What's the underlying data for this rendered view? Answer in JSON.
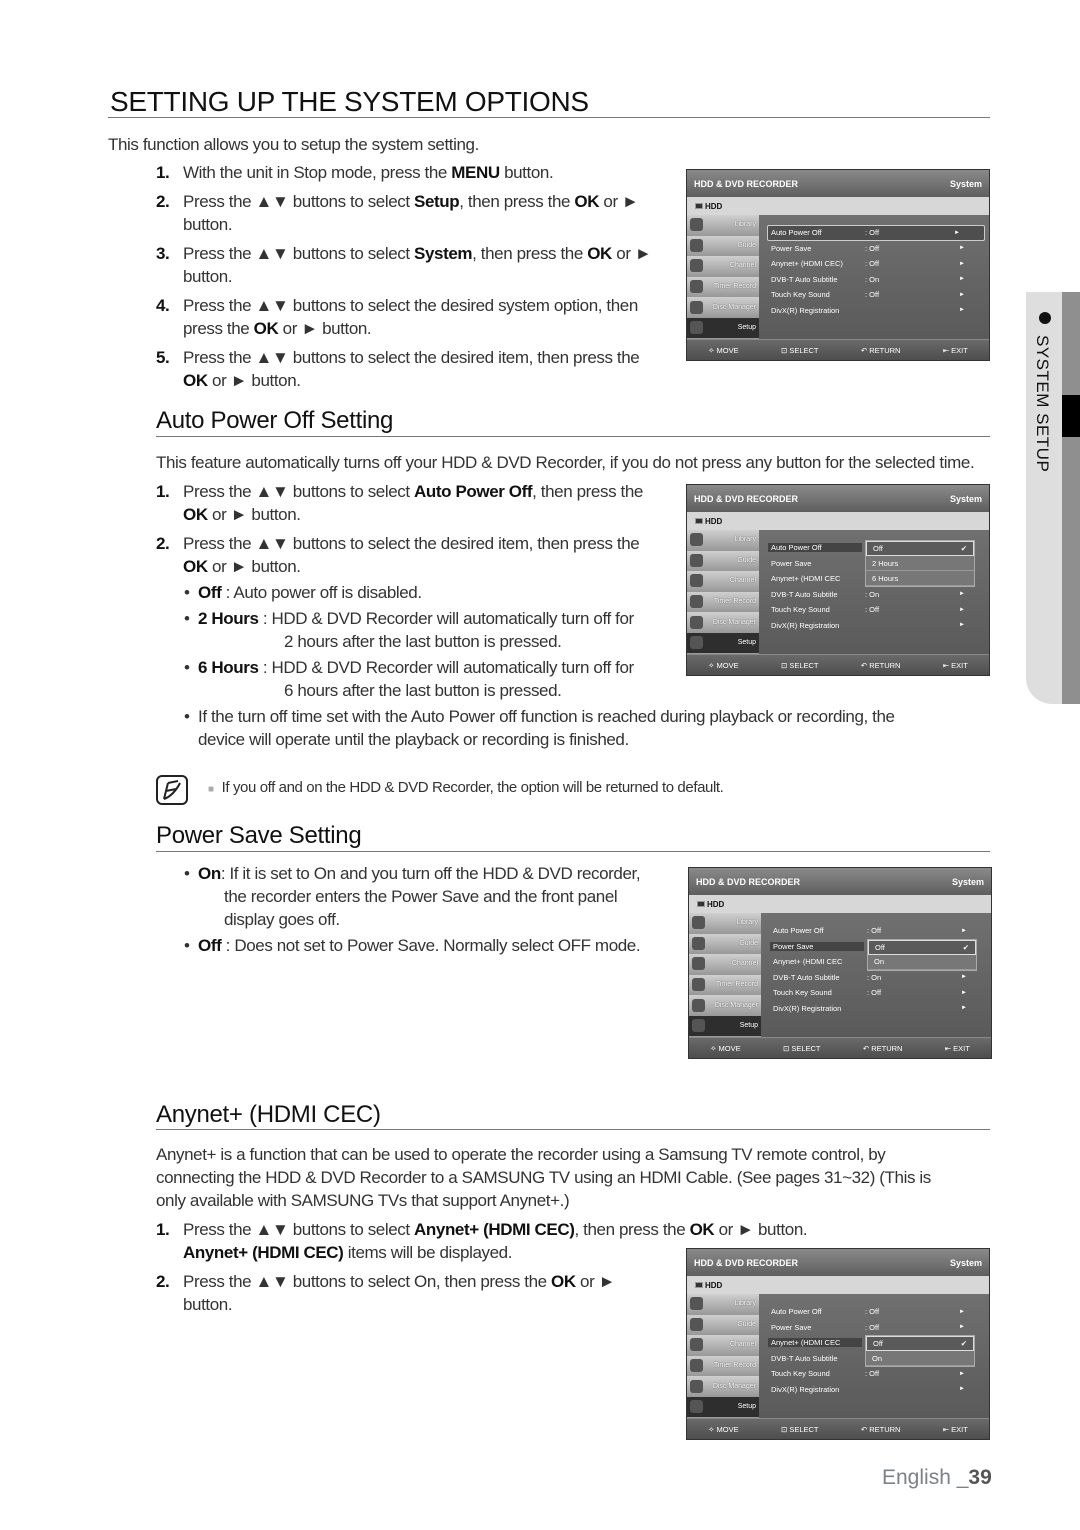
{
  "page_title": "SETTING UP THE SYSTEM OPTIONS",
  "intro": "This function allows you to setup the system setting.",
  "steps_intro": [
    {
      "num": "1.",
      "lines": [
        [
          "With the unit in Stop mode, press the ",
          {
            "b": "MENU"
          },
          " button."
        ]
      ]
    },
    {
      "num": "2.",
      "lines": [
        [
          "Press the ▲▼ buttons to select ",
          {
            "b": "Setup"
          },
          ", then press the ",
          {
            "b": "OK"
          },
          " or ►"
        ],
        [
          "button."
        ]
      ]
    },
    {
      "num": "3.",
      "lines": [
        [
          "Press the ▲▼ buttons to select ",
          {
            "b": "System"
          },
          ", then press the ",
          {
            "b": "OK"
          },
          " or ►"
        ],
        [
          "button."
        ]
      ]
    },
    {
      "num": "4.",
      "lines": [
        [
          "Press the ▲▼ buttons to select the desired system option, then"
        ],
        [
          "press the ",
          {
            "b": "OK"
          },
          " or ► button."
        ]
      ]
    },
    {
      "num": "5.",
      "lines": [
        [
          "Press the ▲▼ buttons to select the desired item, then press the"
        ],
        [
          {
            "b": "OK"
          },
          " or ► button."
        ]
      ]
    }
  ],
  "auto_power": {
    "heading": "Auto Power Off Setting",
    "desc": "This feature automatically turns off your HDD & DVD Recorder, if you do not press any button for the selected time.",
    "steps": [
      {
        "num": "1.",
        "lines": [
          [
            "Press the ▲▼ buttons to select ",
            {
              "b": "Auto Power Off"
            },
            ", then press the"
          ],
          [
            {
              "b": "OK"
            },
            " or ► button."
          ]
        ]
      },
      {
        "num": "2.",
        "lines": [
          [
            "Press the ▲▼ buttons to select the desired item, then press the"
          ],
          [
            {
              "b": "OK"
            },
            " or ► button."
          ]
        ]
      }
    ],
    "bullets": [
      {
        "lines": [
          [
            {
              "b": "Off"
            },
            " : Auto power off is disabled."
          ]
        ]
      },
      {
        "lines": [
          [
            {
              "b": "2 Hours"
            },
            " : HDD & DVD Recorder will automatically turn off for"
          ],
          [
            "2 hours after the last button is pressed."
          ]
        ]
      },
      {
        "lines": [
          [
            {
              "b": "6 Hours"
            },
            " : HDD & DVD Recorder will automatically turn off for"
          ],
          [
            "6 hours after the last button is pressed."
          ]
        ]
      },
      {
        "lines": [
          [
            "If the turn off time set with the Auto Power off function is reached during playback or recording, the"
          ],
          [
            "device will operate until the playback or recording is finished."
          ]
        ]
      }
    ],
    "note": "If you off and on the HDD & DVD Recorder, the option will be returned to default."
  },
  "power_save": {
    "heading": "Power Save Setting",
    "bullets": [
      {
        "lines": [
          [
            {
              "b": "On"
            },
            ": If it is set to On and you turn off the HDD & DVD recorder,"
          ],
          [
            "the recorder enters the Power Save and the front panel"
          ],
          [
            "display goes off."
          ]
        ]
      },
      {
        "lines": [
          [
            {
              "b": "Off"
            },
            " : Does not set to Power Save. Normally select  OFF mode."
          ]
        ]
      }
    ]
  },
  "anynet": {
    "heading": "Anynet+ (HDMI CEC)",
    "desc": [
      "Anynet+ is a function that can be used to operate the recorder using a Samsung TV remote control, by",
      "connecting the HDD & DVD Recorder to a SAMSUNG TV using an HDMI Cable. (See pages 31~32) (This is",
      "only available with SAMSUNG TVs that support Anynet+.)"
    ],
    "steps": [
      {
        "num": "1.",
        "lines": [
          [
            "Press the ▲▼ buttons to select ",
            {
              "b": "Anynet+ (HDMI CEC)"
            },
            ", then press the ",
            {
              "b": "OK"
            },
            " or ► button."
          ],
          [
            {
              "b": "Anynet+ (HDMI CEC)"
            },
            " items will be displayed."
          ]
        ]
      },
      {
        "num": "2.",
        "lines": [
          [
            "Press the ▲▼ buttons to select On, then press the ",
            {
              "b": "OK"
            },
            " or ►"
          ],
          [
            "button."
          ]
        ]
      }
    ]
  },
  "osd_common": {
    "title": "HDD & DVD RECORDER",
    "section": "System",
    "source": "HDD",
    "sidebar": [
      "Library",
      "Guide",
      "Channel",
      "Timer Record",
      "Disc Manager",
      "Setup"
    ],
    "sidebar_active": 5,
    "footer": [
      "MOVE",
      "SELECT",
      "RETURN",
      "EXIT"
    ],
    "footer_icons": [
      "move-icon",
      "select-icon",
      "return-icon",
      "exit-icon"
    ]
  },
  "osd_screens": [
    {
      "rows": [
        [
          "Auto Power Off",
          ": Off"
        ],
        [
          "Power Save",
          ": Off"
        ],
        [
          "Anynet+ (HDMI CEC)",
          ": Off"
        ],
        [
          "DVB-T Auto Subtitle",
          ": On"
        ],
        [
          "Touch Key Sound",
          ": Off"
        ],
        [
          "DivX(R) Registration",
          ""
        ]
      ],
      "selected": 0,
      "popup": null
    },
    {
      "rows": [
        [
          "Auto Power Off",
          ""
        ],
        [
          "Power Save",
          ""
        ],
        [
          "Anynet+ (HDMI CEC",
          ""
        ],
        [
          "DVB-T Auto Subtitle",
          ": On"
        ],
        [
          "Touch Key Sound",
          ": Off"
        ],
        [
          "DivX(R) Registration",
          ""
        ]
      ],
      "selected": 0,
      "popup": {
        "row": 0,
        "options": [
          "Off",
          "2 Hours",
          "6 Hours"
        ],
        "checked": 0
      }
    },
    {
      "rows": [
        [
          "Auto Power Off",
          ": Off"
        ],
        [
          "Power Save",
          ""
        ],
        [
          "Anynet+ (HDMI CEC",
          ""
        ],
        [
          "DVB-T Auto Subtitle",
          ": On"
        ],
        [
          "Touch Key Sound",
          ": Off"
        ],
        [
          "DivX(R) Registration",
          ""
        ]
      ],
      "selected": 1,
      "popup": {
        "row": 1,
        "options": [
          "Off",
          "On"
        ],
        "checked": 0
      }
    },
    {
      "rows": [
        [
          "Auto Power Off",
          ": Off"
        ],
        [
          "Power Save",
          ": Off"
        ],
        [
          "Anynet+ (HDMI CEC",
          ""
        ],
        [
          "DVB-T Auto Subtitle",
          ""
        ],
        [
          "Touch Key Sound",
          ": Off"
        ],
        [
          "DivX(R) Registration",
          ""
        ]
      ],
      "selected": 2,
      "popup": {
        "row": 2,
        "options": [
          "Off",
          "On"
        ],
        "checked": 0
      }
    }
  ],
  "side_tab": "SYSTEM SETUP",
  "footer": {
    "lang": "English _",
    "page": "39"
  }
}
